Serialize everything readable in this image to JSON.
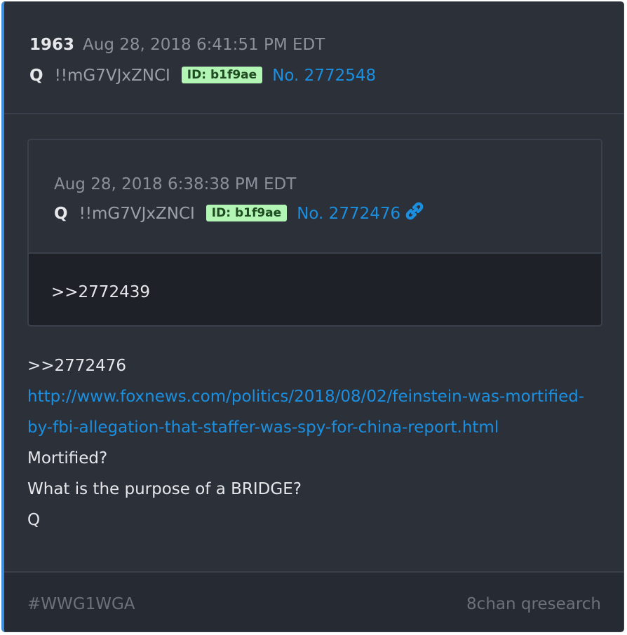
{
  "post": {
    "number": "1963",
    "timestamp": "Aug 28, 2018 6:41:51 PM EDT",
    "author": "Q",
    "tripcode": "!!mG7VJxZNCI",
    "id_badge": "ID: b1f9ae",
    "post_link": "No. 2772548"
  },
  "quoted": {
    "timestamp": "Aug 28, 2018 6:38:38 PM EDT",
    "author": "Q",
    "tripcode": "!!mG7VJxZNCI",
    "id_badge": "ID: b1f9ae",
    "post_link": "No. 2772476",
    "link_icon": "link-icon",
    "body": ">>2772439"
  },
  "body": {
    "reply_ref": ">>2772476",
    "url": "http://www.foxnews.com/politics/2018/08/02/feinstein-was-mortified-by-fbi-allegation-that-staffer-was-spy-for-china-report.html",
    "line1": "Mortified?",
    "line2": "What is the purpose of a BRIDGE?",
    "signature": "Q"
  },
  "footer": {
    "tag": "#WWG1WGA",
    "source": "8chan qresearch"
  },
  "colors": {
    "background": "#2b3039",
    "accent_border": "#3d8ee0",
    "link": "#1b8fe0",
    "id_badge_bg": "#b3f5b5"
  }
}
